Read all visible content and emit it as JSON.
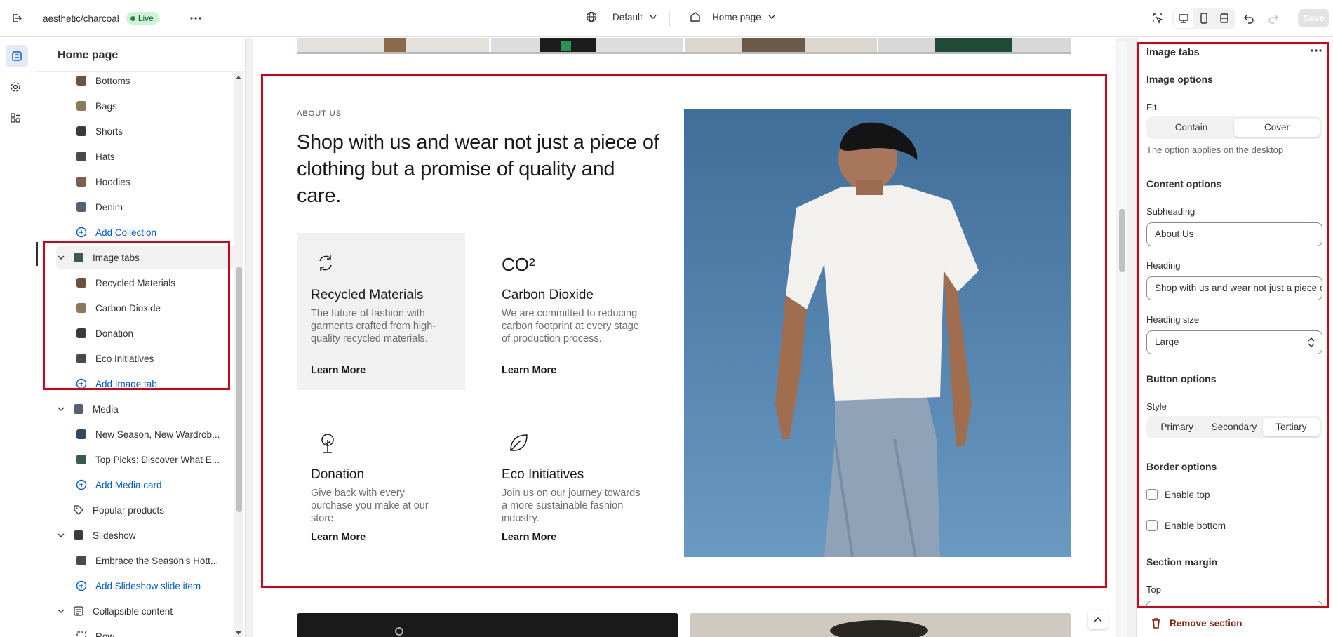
{
  "topbar": {
    "store": "aesthetic/charcoal",
    "status": "Live",
    "theme_selector": "Default",
    "page_selector": "Home page",
    "save_label": "Save"
  },
  "left_panel": {
    "title": "Home page",
    "items": [
      {
        "label": "Bottoms",
        "icon": "collection-thumb"
      },
      {
        "label": "Bags",
        "icon": "collection-thumb"
      },
      {
        "label": "Shorts",
        "icon": "collection-thumb"
      },
      {
        "label": "Hats",
        "icon": "collection-thumb"
      },
      {
        "label": "Hoodies",
        "icon": "collection-thumb"
      },
      {
        "label": "Denim",
        "icon": "collection-thumb"
      },
      {
        "label": "Add Collection",
        "icon": "plus-circle-icon"
      },
      {
        "label": "Image tabs",
        "icon": "image-tabs-icon"
      },
      {
        "label": "Recycled Materials",
        "icon": "image-thumb"
      },
      {
        "label": "Carbon Dioxide",
        "icon": "image-thumb"
      },
      {
        "label": "Donation",
        "icon": "image-thumb"
      },
      {
        "label": "Eco Initiatives",
        "icon": "image-thumb"
      },
      {
        "label": "Add Image tab",
        "icon": "plus-circle-icon"
      },
      {
        "label": "Media",
        "icon": "media-icon"
      },
      {
        "label": "New Season, New Wardrob...",
        "icon": "image-thumb"
      },
      {
        "label": "Top Picks: Discover What E...",
        "icon": "image-thumb"
      },
      {
        "label": "Add Media card",
        "icon": "plus-circle-icon"
      },
      {
        "label": "Popular products",
        "icon": "tag-icon"
      },
      {
        "label": "Slideshow",
        "icon": "slideshow-icon"
      },
      {
        "label": "Embrace the Season's Hott...",
        "icon": "image-thumb"
      },
      {
        "label": "Add Slideshow slide item",
        "icon": "plus-circle-icon"
      },
      {
        "label": "Collapsible content",
        "icon": "collapsible-icon"
      },
      {
        "label": "Row",
        "icon": "row-icon"
      }
    ]
  },
  "preview": {
    "subheading": "ABOUT US",
    "heading": "Shop with us and wear not just a piece of clothing but a promise of quality and care.",
    "features": [
      {
        "icon": "recycle-icon",
        "title": "Recycled Materials",
        "desc": "The future of fashion with garments crafted from high-quality recycled materials.",
        "link": "Learn More"
      },
      {
        "icon": "co2-icon",
        "icon_text": "CO²",
        "title": "Carbon Dioxide",
        "desc": "We are committed to reducing carbon footprint at every stage of production process.",
        "link": "Learn More"
      },
      {
        "icon": "tree-icon",
        "title": "Donation",
        "desc": "Give back with every purchase you make at our store.",
        "link": "Learn More"
      },
      {
        "icon": "leaf-icon",
        "title": "Eco Initiatives",
        "desc": "Join us on our journey towards a more sustainable fashion industry.",
        "link": "Learn More"
      }
    ]
  },
  "right_panel": {
    "title": "Image tabs",
    "image_options": "Image options",
    "fit_label": "Fit",
    "fit_options": [
      "Contain",
      "Cover"
    ],
    "fit_selected": "Cover",
    "fit_help": "The option applies on the desktop",
    "content_options": "Content options",
    "subheading_label": "Subheading",
    "subheading_value": "About Us",
    "heading_label": "Heading",
    "heading_value": "Shop with us and wear not just a piece of clothing but a promise of quality and care.",
    "heading_size_label": "Heading size",
    "heading_size_value": "Large",
    "button_options": "Button options",
    "style_label": "Style",
    "style_options": [
      "Primary",
      "Secondary",
      "Tertiary"
    ],
    "style_selected": "Tertiary",
    "border_options": "Border options",
    "enable_top": "Enable top",
    "enable_bottom": "Enable bottom",
    "section_margin": "Section margin",
    "top_label": "Top",
    "remove_section": "Remove section"
  },
  "colors": {
    "accent_blue": "#005bd3",
    "highlight_red": "#d0021b",
    "danger": "#8e1f0b",
    "hero_sky": "#4f7fa8"
  }
}
